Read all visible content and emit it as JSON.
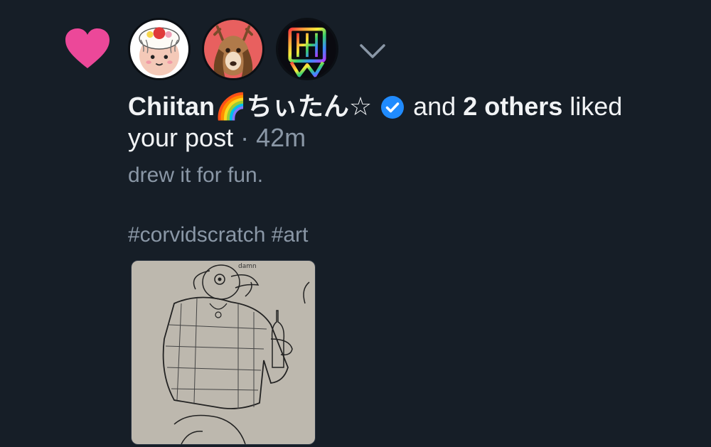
{
  "notification": {
    "type_icon": "heart-icon",
    "liker_name": "Chiitan🌈ちぃたん☆",
    "verified_icon": "verified-check-icon",
    "connector": " and ",
    "others": "2 others",
    "action_suffix": " liked",
    "action_line2": "your post",
    "separator": " · ",
    "time": "42m",
    "expand_icon": "chevron-down-icon"
  },
  "avatars": [
    {
      "name": "avatar-chiitan"
    },
    {
      "name": "avatar-deer"
    },
    {
      "name": "avatar-rainbow-logo"
    }
  ],
  "post": {
    "text": "drew it for fun.",
    "hashtags": [
      "#corvidscratch",
      "#art"
    ],
    "image_alt": "sketch of crow character"
  },
  "colors": {
    "background": "#161e27",
    "heart": "#ec4899",
    "verified": "#208bfe",
    "muted_text": "#8a97a6"
  }
}
